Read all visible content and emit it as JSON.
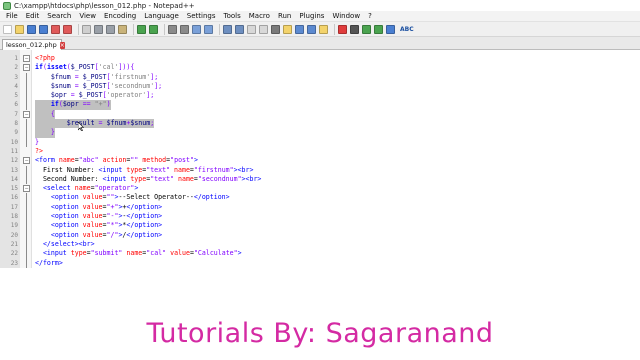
{
  "window": {
    "title": "C:\\xampp\\htdocs\\php\\lesson_012.php - Notepad++"
  },
  "menu": [
    "File",
    "Edit",
    "Search",
    "View",
    "Encoding",
    "Language",
    "Settings",
    "Tools",
    "Macro",
    "Run",
    "Plugins",
    "Window",
    "?"
  ],
  "toolbar": {
    "icons": [
      "new-file-icon",
      "open-file-icon",
      "save-icon",
      "save-all-icon",
      "close-icon",
      "close-all-icon",
      "print-icon",
      "cut-icon",
      "copy-icon",
      "paste-icon",
      "undo-icon",
      "redo-icon",
      "find-icon",
      "replace-icon",
      "zoom-in-icon",
      "zoom-out-icon",
      "sync-vertical-icon",
      "sync-horizontal-icon",
      "word-wrap-icon",
      "show-all-chars-icon",
      "indent-guide-icon",
      "udl-icon",
      "doc-map-icon",
      "function-list-icon",
      "folder-workspace-icon",
      "record-macro-icon",
      "stop-record-icon",
      "play-macro-icon",
      "run-macro-multiple-icon",
      "save-macro-icon",
      "spellcheck-icon"
    ],
    "spellcheck_label": "ABC"
  },
  "tab": {
    "label": "lesson_012.php"
  },
  "editor": {
    "lines": [
      {
        "n": "1",
        "fold": "box",
        "sel": false,
        "html": "<span class='ph'>&lt;?php</span>"
      },
      {
        "n": "2",
        "fold": "box",
        "sel": false,
        "html": "<span class='kw'>if</span><span class='op'>(</span><span class='kw'>isset</span><span class='op'>(</span><span class='vr'>$_POST</span><span class='op'>[</span><span class='str'>'cal'</span><span class='op'>])){</span>"
      },
      {
        "n": "3",
        "fold": "bar",
        "sel": false,
        "html": "    <span class='vr'>$fnum</span> <span class='op'>=</span> <span class='vr'>$_POST</span><span class='op'>[</span><span class='str'>'firstnum'</span><span class='op'>];</span>"
      },
      {
        "n": "4",
        "fold": "bar",
        "sel": false,
        "html": "    <span class='vr'>$snum</span> <span class='op'>=</span> <span class='vr'>$_POST</span><span class='op'>[</span><span class='str'>'secondnum'</span><span class='op'>];</span>"
      },
      {
        "n": "5",
        "fold": "bar",
        "sel": false,
        "html": "    <span class='vr'>$opr</span> <span class='op'>=</span> <span class='vr'>$_POST</span><span class='op'>[</span><span class='str'>'operator'</span><span class='op'>];</span>"
      },
      {
        "n": "6",
        "fold": "bar",
        "sel": true,
        "html": "    <span class='kw'>if</span><span class='op'>(</span><span class='vr'>$opr</span> <span class='op'>==</span> <span class='str'>\"+\"</span><span class='op'>)</span>"
      },
      {
        "n": "7",
        "fold": "box",
        "sel": true,
        "html": "    <span class='op'>{</span>"
      },
      {
        "n": "8",
        "fold": "bar",
        "sel": true,
        "html": "        <span class='vr'>$result</span> <span class='op'>=</span> <span class='vr'>$fnum</span><span class='op'>+</span><span class='vr'>$snum</span><span class='op'>;</span>"
      },
      {
        "n": "9",
        "fold": "bar",
        "sel": true,
        "html": "    <span class='op'>}</span>"
      },
      {
        "n": "10",
        "fold": "bar",
        "sel": false,
        "html": "<span class='op'>}</span>"
      },
      {
        "n": "11",
        "fold": "none",
        "sel": false,
        "html": "<span class='ph'>?&gt;</span>"
      },
      {
        "n": "12",
        "fold": "box",
        "sel": false,
        "html": "<span class='tag'>&lt;form</span> <span class='attr'>name</span><span class='tx'>=</span><span class='aval'>\"abc\"</span> <span class='attr'>action</span><span class='tx'>=</span><span class='aval'>\"\"</span> <span class='attr'>method</span><span class='tx'>=</span><span class='aval'>\"post\"</span><span class='tag'>&gt;</span>"
      },
      {
        "n": "13",
        "fold": "bar",
        "sel": false,
        "html": "  <span class='tx'>First Number: </span><span class='tag'>&lt;input</span> <span class='attr'>type</span><span class='tx'>=</span><span class='aval'>\"text\"</span> <span class='attr'>name</span><span class='tx'>=</span><span class='aval'>\"firstnum\"</span><span class='tag'>&gt;&lt;br&gt;</span>"
      },
      {
        "n": "14",
        "fold": "bar",
        "sel": false,
        "html": "  <span class='tx'>Second Number: </span><span class='tag'>&lt;input</span> <span class='attr'>type</span><span class='tx'>=</span><span class='aval'>\"text\"</span> <span class='attr'>name</span><span class='tx'>=</span><span class='aval'>\"secondnum\"</span><span class='tag'>&gt;&lt;br&gt;</span>"
      },
      {
        "n": "15",
        "fold": "box",
        "sel": false,
        "html": "  <span class='tag'>&lt;select</span> <span class='attr'>name</span><span class='tx'>=</span><span class='aval'>\"operator\"</span><span class='tag'>&gt;</span>"
      },
      {
        "n": "16",
        "fold": "bar",
        "sel": false,
        "html": "    <span class='tag'>&lt;option</span> <span class='attr'>value</span><span class='tx'>=</span><span class='aval'>\"\"</span><span class='tag'>&gt;</span><span class='tx'>--Select Operator--</span><span class='tag'>&lt;/option&gt;</span>"
      },
      {
        "n": "17",
        "fold": "bar",
        "sel": false,
        "html": "    <span class='tag'>&lt;option</span> <span class='attr'>value</span><span class='tx'>=</span><span class='aval'>\"+\"</span><span class='tag'>&gt;</span><span class='tx'>+</span><span class='tag'>&lt;/option&gt;</span>"
      },
      {
        "n": "18",
        "fold": "bar",
        "sel": false,
        "html": "    <span class='tag'>&lt;option</span> <span class='attr'>value</span><span class='tx'>=</span><span class='aval'>\"-\"</span><span class='tag'>&gt;</span><span class='tx'>-</span><span class='tag'>&lt;/option&gt;</span>"
      },
      {
        "n": "19",
        "fold": "bar",
        "sel": false,
        "html": "    <span class='tag'>&lt;option</span> <span class='attr'>value</span><span class='tx'>=</span><span class='aval'>\"*\"</span><span class='tag'>&gt;</span><span class='tx'>*</span><span class='tag'>&lt;/option&gt;</span>"
      },
      {
        "n": "20",
        "fold": "bar",
        "sel": false,
        "html": "    <span class='tag'>&lt;option</span> <span class='attr'>value</span><span class='tx'>=</span><span class='aval'>\"/\"</span><span class='tag'>&gt;</span><span class='tx'>/</span><span class='tag'>&lt;/option&gt;</span>"
      },
      {
        "n": "21",
        "fold": "bar",
        "sel": false,
        "html": "  <span class='tag'>&lt;/select&gt;&lt;br&gt;</span>"
      },
      {
        "n": "22",
        "fold": "bar",
        "sel": false,
        "html": "  <span class='tag'>&lt;input</span> <span class='attr'>type</span><span class='tx'>=</span><span class='aval'>\"submit\"</span> <span class='attr'>name</span><span class='tx'>=</span><span class='aval'>\"cal\"</span> <span class='attr'>value</span><span class='tx'>=</span><span class='aval'>\"Calculate\"</span><span class='tag'>&gt;</span>"
      },
      {
        "n": "23",
        "fold": "bar",
        "sel": false,
        "html": "<span class='tag'>&lt;/form&gt;</span>"
      }
    ]
  },
  "caption": "Tutorials By: Sagaranand",
  "colors": {
    "caption": "#d42aa3",
    "selection": "#c0c0c0",
    "keyword": "#0000ff",
    "string": "#808080",
    "operator": "#8000ff",
    "php_tag": "#ff0000"
  }
}
